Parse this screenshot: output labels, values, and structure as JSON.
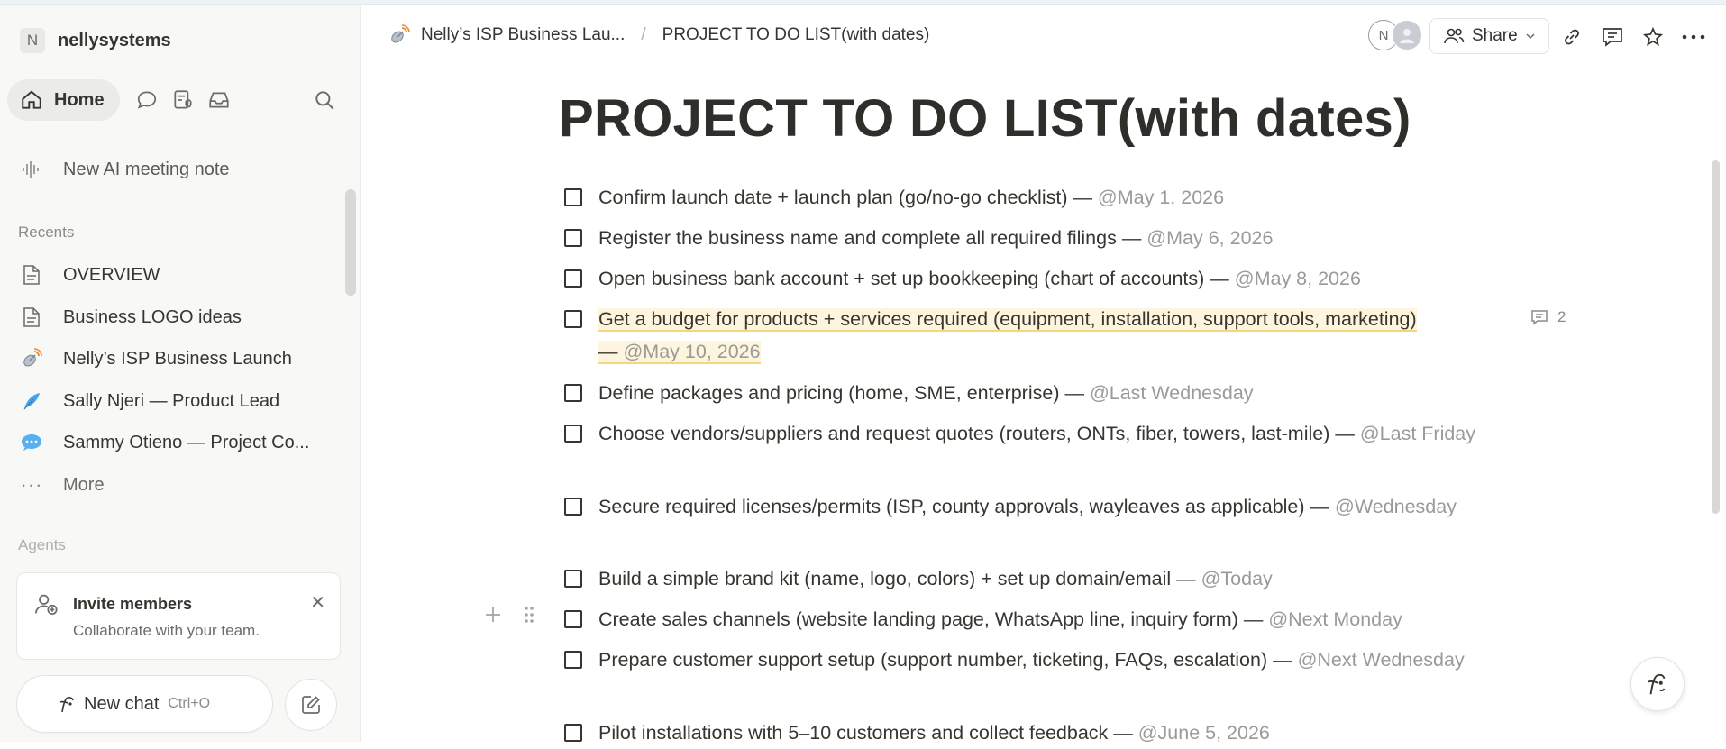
{
  "workspace": {
    "initial": "N",
    "name": "nellysystems"
  },
  "nav": {
    "home_label": "Home"
  },
  "sidebar": {
    "new_ai_note": "New AI meeting note",
    "recents_label": "Recents",
    "recents": [
      {
        "label": "OVERVIEW",
        "icon": "page-icon"
      },
      {
        "label": "Business LOGO ideas",
        "icon": "page-icon"
      },
      {
        "label": "Nelly’s ISP Business Launch",
        "icon": "satellite-icon"
      },
      {
        "label": "Sally Njeri — Product Lead",
        "icon": "feather-icon"
      },
      {
        "label": "Sammy Otieno — Project Co...",
        "icon": "speech-bubble-icon"
      }
    ],
    "more_label": "More",
    "agents_label": "Agents",
    "invite": {
      "title": "Invite members",
      "subtitle": "Collaborate with your team."
    },
    "new_chat": {
      "label": "New chat",
      "shortcut": "Ctrl+O"
    }
  },
  "topbar": {
    "breadcrumb_parent": "Nelly’s ISP Business Lau...",
    "breadcrumb_current": "PROJECT TO DO LIST(with dates)",
    "avatar_initial": "N",
    "share_label": "Share"
  },
  "page": {
    "title": "PROJECT TO DO LIST(with dates)",
    "todos": [
      {
        "text": "Confirm launch date + launch plan (go/no-go checklist) — ",
        "date": "@May 1, 2026"
      },
      {
        "text": "Register the business name and complete all required filings — ",
        "date": "@May 6, 2026"
      },
      {
        "text": "Open business bank account + set up bookkeeping (chart of accounts) — ",
        "date": "@May 8, 2026"
      },
      {
        "text": "Get a budget for products + services required (equipment, installation, support tools, marketing) — ",
        "date": "@May 10, 2026",
        "comments": "2"
      },
      {
        "text": "Define packages and pricing (home, SME, enterprise) — ",
        "date": "@Last Wednesday"
      },
      {
        "text": "Choose vendors/suppliers and request quotes (routers, ONTs, fiber, towers, last-mile) — ",
        "date": "@Last Friday"
      },
      {
        "text": "Secure required licenses/permits (ISP, county approvals, wayleaves as applicable) — ",
        "date": "@Wednesday"
      },
      {
        "text": "Build a simple brand kit (name, logo, colors) + set up domain/email — ",
        "date": "@Today"
      },
      {
        "text": "Create sales channels (website landing page, WhatsApp line, inquiry form) — ",
        "date": "@Next Monday"
      },
      {
        "text": "Prepare customer support setup (support number, ticketing, FAQs, escalation) — ",
        "date": "@Next Wednesday"
      },
      {
        "text": "Pilot installations with 5–10 customers and collect feedback — ",
        "date": "@June 5, 2026"
      }
    ]
  },
  "colors": {
    "mention": "#9b9a97",
    "highlight_bg": "#fdf5dd",
    "highlight_underline": "#f3d77a"
  }
}
